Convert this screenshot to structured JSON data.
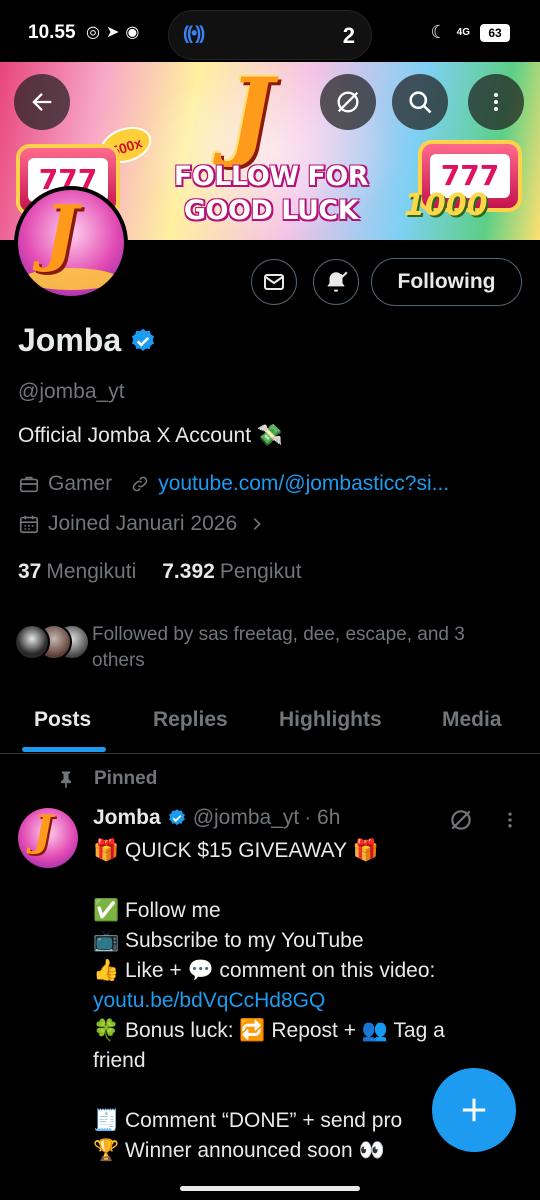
{
  "status_bar": {
    "time": "10.55",
    "island_count": "2",
    "network": "4G",
    "battery": "63"
  },
  "banner": {
    "line1": "FOLLOW FOR",
    "line2": "GOOD LUCK",
    "slot_left": "777",
    "slot_right": "777",
    "badge": "500x",
    "amount": "1000"
  },
  "profile": {
    "avatar_letter": "J",
    "name": "Jomba",
    "handle": "@jomba_yt",
    "bio": "Official Jomba X Account 💸",
    "category": "Gamer",
    "link": "youtube.com/@jombasticc?si...",
    "joined": "Joined Januari 2026",
    "following_count": "37",
    "following_label": "Mengikuti",
    "followers_count": "7.392",
    "followers_label": "Pengikut",
    "followed_by": "Followed by sas freetag, dee, escape, and 3 others"
  },
  "actions": {
    "following_label": "Following"
  },
  "tabs": [
    {
      "label": "Posts",
      "active": true
    },
    {
      "label": "Replies",
      "active": false
    },
    {
      "label": "Highlights",
      "active": false
    },
    {
      "label": "Media",
      "active": false
    }
  ],
  "post": {
    "pinned_label": "Pinned",
    "author": "Jomba",
    "handle": "@jomba_yt",
    "time": "· 6h",
    "lines": [
      "🎁 QUICK $15 GIVEAWAY 🎁",
      "",
      "✅ Follow me",
      "📺 Subscribe to my YouTube",
      "👍 Like + 💬 comment on this video:",
      "youtu.be/bdVqCcHd8GQ",
      "🍀 Bonus luck: 🔁 Repost + 👥 Tag a",
      "friend",
      "",
      "🧾 Comment “DONE” + send pro",
      "🏆 Winner announced soon 👀"
    ]
  },
  "colors": {
    "accent": "#1d9bf0",
    "muted": "#71767b",
    "text": "#e7e9ea",
    "border": "#2f3336"
  }
}
